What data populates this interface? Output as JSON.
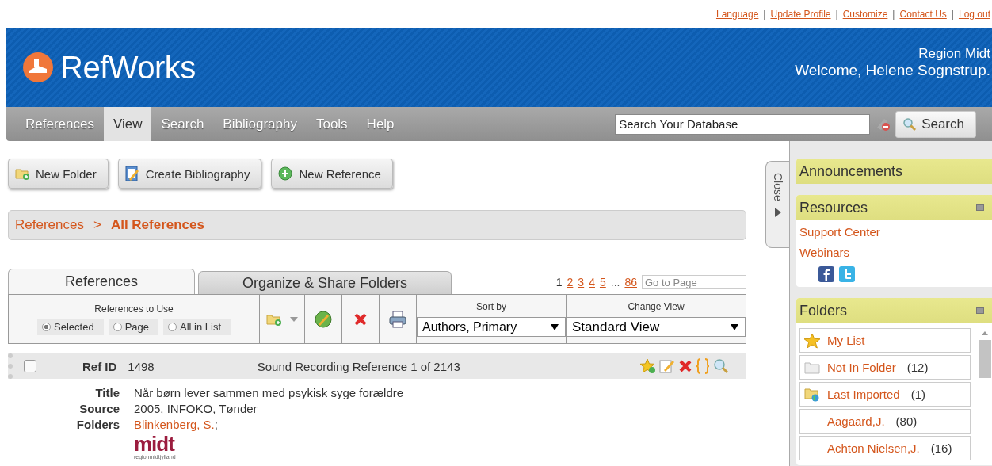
{
  "top_links": [
    {
      "label": "Language",
      "separator": "|"
    },
    {
      "label": "Update Profile",
      "separator": "|"
    },
    {
      "label": "Customize",
      "separator": "|"
    },
    {
      "label": "Contact Us",
      "separator": "|"
    },
    {
      "label": "Log out"
    }
  ],
  "header": {
    "brand": "RefWorks",
    "org": "Region Midt",
    "welcome": "Welcome, Helene Sognstrup."
  },
  "nav": [
    {
      "label": "References",
      "selected": false
    },
    {
      "label": "View",
      "selected": true
    },
    {
      "label": "Search",
      "selected": false
    },
    {
      "label": "Bibliography",
      "selected": false
    },
    {
      "label": "Tools",
      "selected": false
    },
    {
      "label": "Help",
      "selected": false
    }
  ],
  "search": {
    "placeholder": "Search Your Database",
    "button": "Search"
  },
  "actions": [
    {
      "kind": "folder",
      "label": "New Folder"
    },
    {
      "kind": "bibliography",
      "label": "Create Bibliography"
    },
    {
      "kind": "add",
      "label": "New Reference"
    }
  ],
  "breadcrumb": {
    "parent": "References",
    "separator": ">",
    "current": "All References"
  },
  "tabs": [
    {
      "label": "References",
      "selected": true
    },
    {
      "label": "Organize & Share Folders",
      "selected": false
    }
  ],
  "pagination": {
    "pages": [
      {
        "label": "1",
        "selected": true
      },
      {
        "label": "2",
        "selected": false
      },
      {
        "label": "3",
        "selected": false
      },
      {
        "label": "4",
        "selected": false
      },
      {
        "label": "5",
        "selected": false
      },
      {
        "label": "...",
        "kind": "ellipsis"
      },
      {
        "label": "86",
        "selected": false
      }
    ],
    "goto_placeholder": "Go to Page"
  },
  "references_to_use": {
    "label": "References to Use",
    "options": [
      {
        "label": "Selected",
        "selected": true
      },
      {
        "label": "Page",
        "selected": false
      },
      {
        "label": "All in List",
        "selected": false
      }
    ]
  },
  "sort_by": {
    "label": "Sort by",
    "value": "Authors, Primary"
  },
  "change_view": {
    "label": "Change View",
    "value": "Standard View"
  },
  "record": {
    "checked": false,
    "id_label": "Ref ID",
    "id": "1498",
    "type": "Sound Recording Reference 1 of 2143",
    "fields": [
      {
        "label": "Title",
        "value": "Når børn lever sammen med psykisk syge forældre",
        "kind": "text"
      },
      {
        "label": "Source",
        "value": "2005, INFOKO, Tønder",
        "kind": "text"
      },
      {
        "label": "Folders",
        "value": "Blinkenberg, S.",
        "suffix": ";",
        "kind": "link"
      }
    ],
    "logo": {
      "main": "midt",
      "sub": "regionmidtjylland"
    }
  },
  "close_tab": "Close",
  "sidebar": {
    "announcements": "Announcements",
    "resources": {
      "title": "Resources",
      "links": [
        "Support Center",
        "Webinars"
      ]
    },
    "folders": {
      "title": "Folders",
      "items": [
        {
          "kind": "star",
          "name": "My List"
        },
        {
          "kind": "folder",
          "name": "Not In Folder",
          "count": "(12)"
        },
        {
          "kind": "imported",
          "name": "Last Imported",
          "count": "(1)"
        },
        {
          "kind": "plain",
          "name": "Aagaard,J.",
          "count": "(80)"
        },
        {
          "kind": "plain",
          "name": "Achton Nielsen,J.",
          "count": "(16)"
        }
      ]
    }
  }
}
